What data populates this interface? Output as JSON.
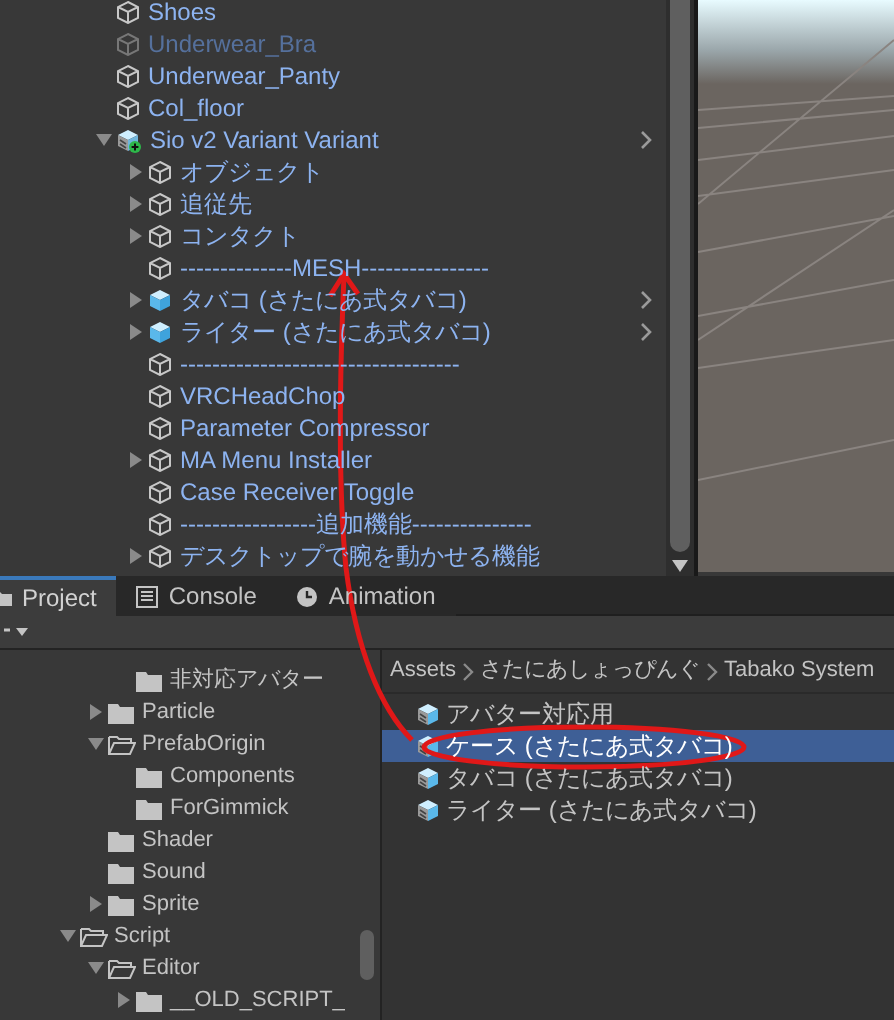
{
  "hierarchy": {
    "items": [
      {
        "label": "Shoes",
        "kind": "object",
        "active": true
      },
      {
        "label": "Underwear_Bra",
        "kind": "object",
        "active": false
      },
      {
        "label": "Underwear_Panty",
        "kind": "object",
        "active": true
      },
      {
        "label": "Col_floor",
        "kind": "object",
        "active": true
      },
      {
        "label": "Sio v2 Variant Variant",
        "kind": "variant",
        "active": true,
        "expanded": true,
        "submenu": true,
        "children": [
          {
            "label": "オブジェクト",
            "kind": "object",
            "active": true,
            "expanded": false
          },
          {
            "label": "追従先",
            "kind": "object",
            "active": true,
            "expanded": false
          },
          {
            "label": "コンタクト",
            "kind": "object",
            "active": true,
            "expanded": false
          },
          {
            "label": "--------------MESH----------------",
            "kind": "object",
            "active": true
          },
          {
            "label": "タバコ (さたにあ式タバコ)",
            "kind": "prefab",
            "active": true,
            "expanded": false,
            "submenu": true
          },
          {
            "label": "ライター (さたにあ式タバコ)",
            "kind": "prefab",
            "active": true,
            "expanded": false,
            "submenu": true
          },
          {
            "label": "-----------------------------------",
            "kind": "object",
            "active": true
          },
          {
            "label": "VRCHeadChop",
            "kind": "object",
            "active": true
          },
          {
            "label": "Parameter Compressor",
            "kind": "object",
            "active": true
          },
          {
            "label": "MA Menu Installer",
            "kind": "object",
            "active": true,
            "expanded": false
          },
          {
            "label": "Case Receiver Toggle",
            "kind": "object",
            "active": true
          },
          {
            "label": "-----------------追加機能---------------",
            "kind": "object",
            "active": true
          },
          {
            "label": "デスクトップで腕を動かせる機能",
            "kind": "object",
            "active": true,
            "expanded": false
          }
        ]
      }
    ]
  },
  "tabs": [
    {
      "label": "Project",
      "kind": "folder",
      "selected": true
    },
    {
      "label": "Console",
      "kind": "console",
      "selected": false
    },
    {
      "label": "Animation",
      "kind": "clock",
      "selected": false
    }
  ],
  "folders": [
    {
      "children": [
        {
          "children": [
            {
              "label": "非対応アバター"
            }
          ]
        },
        {
          "label": "Particle",
          "expanded": false
        },
        {
          "label": "PrefabOrigin",
          "expanded": true,
          "children": [
            {
              "label": "Components"
            },
            {
              "label": "ForGimmick"
            }
          ]
        },
        {
          "label": "Shader"
        },
        {
          "label": "Sound"
        },
        {
          "label": "Sprite",
          "expanded": false
        }
      ]
    },
    {
      "label": "Script",
      "expanded": true,
      "children": [
        {
          "label": "Editor",
          "expanded": true,
          "children": [
            {
              "label": "__OLD_SCRIPT_",
              "expanded": false
            }
          ]
        }
      ]
    }
  ],
  "breadcrumb": [
    "Assets",
    "さたにあしょっぴんぐ",
    "Tabako System"
  ],
  "assets": [
    {
      "label": "アバター対応用",
      "selected": false
    },
    {
      "label": "ケース (さたにあ式タバコ)",
      "selected": true
    },
    {
      "label": "タバコ (さたにあ式タバコ)",
      "selected": false
    },
    {
      "label": "ライター (さたにあ式タバコ)",
      "selected": false
    }
  ]
}
